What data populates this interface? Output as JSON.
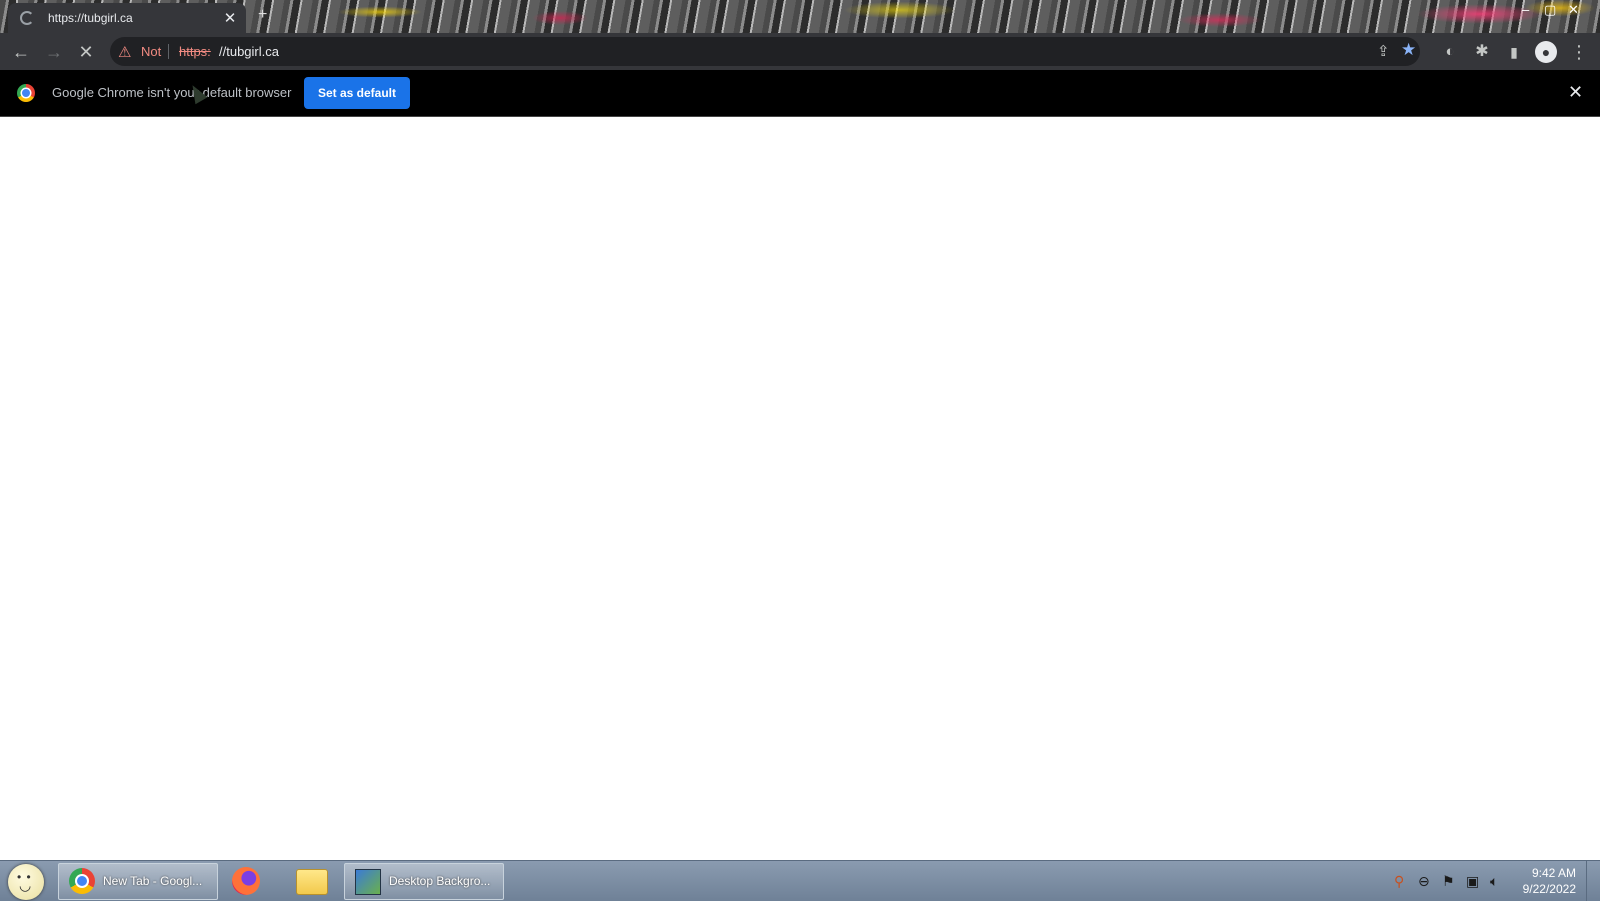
{
  "browser": {
    "tab": {
      "title": "https://tubgirl.ca",
      "close": "✕"
    },
    "window_controls": {
      "minimize": "–",
      "maximize": "▢",
      "close": "✕"
    },
    "toolbar": {
      "back": "←",
      "forward": "→",
      "stop": "✕",
      "security_warning": "Not",
      "url_scheme": "https:",
      "url_rest": "//tubgirl.ca",
      "share": "⇪",
      "bookmark": "★",
      "extensions": "✱",
      "sidepanel": "▮",
      "menu": "⋮"
    },
    "infobar": {
      "message": "Google Chrome isn't your default browser",
      "button": "Set as default",
      "close": "✕"
    }
  },
  "taskbar": {
    "items": [
      {
        "label": "New Tab - Googl..."
      },
      {
        "label": "Desktop Backgro..."
      }
    ],
    "clock": {
      "time": "9:42 AM",
      "date": "9/22/2022"
    }
  },
  "colors": {
    "accent": "#1a73e8",
    "warning": "#f28b82",
    "toolbar": "#35363a"
  }
}
